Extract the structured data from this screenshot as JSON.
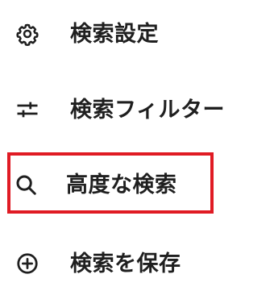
{
  "menu": {
    "items": [
      {
        "label": "検索設定",
        "icon": "gear-icon"
      },
      {
        "label": "検索フィルター",
        "icon": "sliders-icon"
      },
      {
        "label": "高度な検索",
        "icon": "search-icon",
        "highlighted": true
      },
      {
        "label": "検索を保存",
        "icon": "plus-circle-icon"
      }
    ]
  },
  "colors": {
    "text": "#1f1f1f",
    "highlight_border": "#e01b24",
    "background": "#ffffff"
  }
}
